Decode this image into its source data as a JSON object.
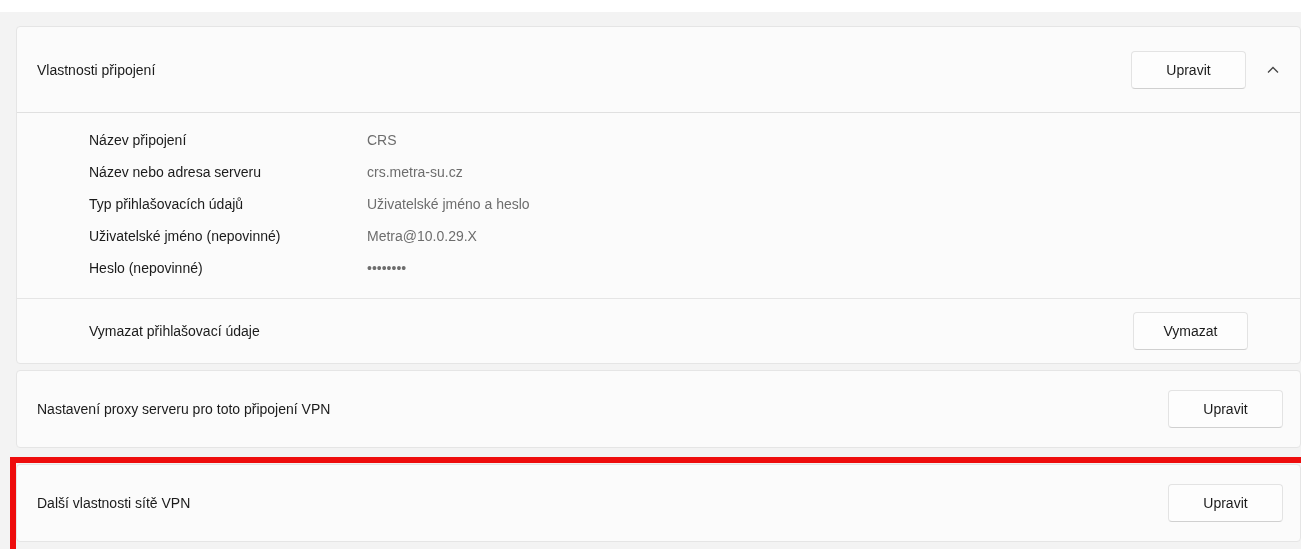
{
  "connection_properties": {
    "title": "Vlastnosti připojení",
    "edit_button": "Upravit",
    "expanded": true,
    "details": [
      {
        "label": "Název připojení",
        "value": "CRS"
      },
      {
        "label": "Název nebo adresa serveru",
        "value": "crs.metra-su.cz"
      },
      {
        "label": "Typ přihlašovacích údajů",
        "value": "Uživatelské jméno a heslo"
      },
      {
        "label": "Uživatelské jméno (nepovinné)",
        "value": "Metra@10.0.29.X"
      },
      {
        "label": "Heslo (nepovinné)",
        "value": "••••••••"
      }
    ],
    "clear_row": {
      "label": "Vymazat přihlašovací údaje",
      "button": "Vymazat"
    }
  },
  "settings": [
    {
      "label": "Nastavení proxy serveru pro toto připojení VPN",
      "button": "Upravit",
      "highlighted": false
    },
    {
      "label": "Další vlastnosti sítě VPN",
      "button": "Upravit",
      "highlighted": true
    }
  ]
}
